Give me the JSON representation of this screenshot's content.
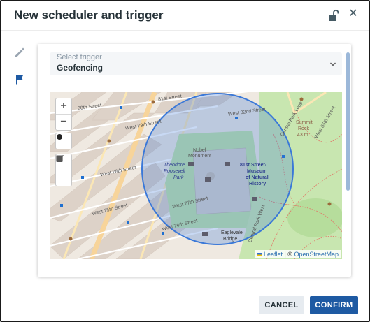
{
  "dialog": {
    "title": "New scheduler and trigger",
    "lock_icon": "unlock-icon",
    "close_icon": "close-icon"
  },
  "sidebar": {
    "items": [
      {
        "name": "edit",
        "icon": "pencil-icon"
      },
      {
        "name": "trigger",
        "icon": "flag-icon"
      }
    ]
  },
  "trigger_select": {
    "label": "Select trigger",
    "value": "Geofencing"
  },
  "map": {
    "zoom_in": "+",
    "zoom_out": "−",
    "attribution_leaflet": "Leaflet",
    "attribution_separator": " | © ",
    "attribution_osm": "OpenStreetMap",
    "labels": {
      "theodore": "Theodore",
      "roosevelt": "Roosevelt",
      "park": "Park",
      "museum1": "81st Street-",
      "museum2": "Museum",
      "museum3": "of Natural",
      "museum4": "History",
      "nobel1": "Nobel",
      "nobel2": "Monument",
      "summit1": "Summit",
      "summit2": "Rock",
      "summit3": "43 m",
      "eaglevale1": "Eaglevale",
      "eaglevale2": "Bridge",
      "w81": "81st Street",
      "w82": "West 82nd Street",
      "w79": "West 79th Street",
      "w78": "West 78th Street",
      "w77": "West 77th Street",
      "w76": "West 76th Street",
      "w75": "West 75th Street",
      "w85": "West 85th Street",
      "cpw": "Central Park West",
      "loop": "Central Park Loop",
      "street80": "80th Street"
    },
    "colors": {
      "geofence": "#3a78d8",
      "park": "#c8e6b0",
      "buildings": "#e0d6cd"
    }
  },
  "footer": {
    "cancel": "CANCEL",
    "confirm": "CONFIRM"
  }
}
